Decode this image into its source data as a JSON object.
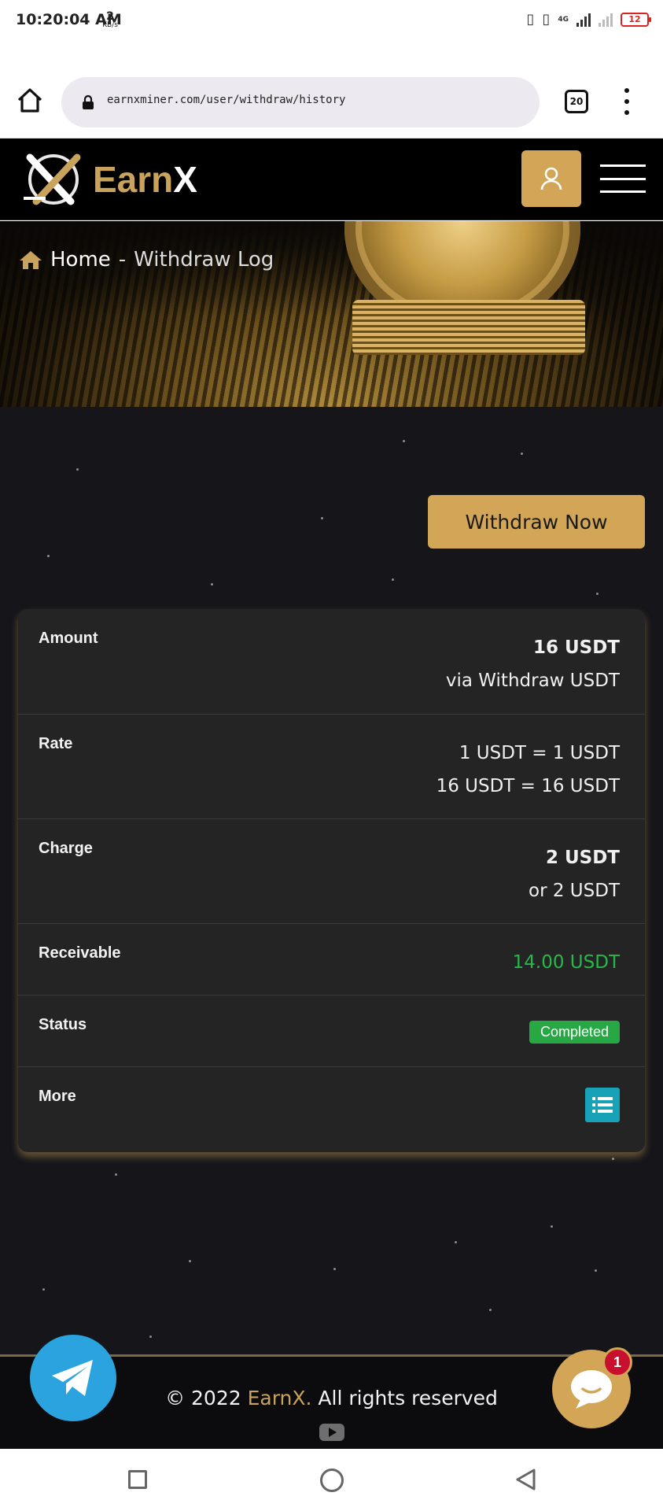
{
  "status_bar": {
    "time": "10:20:04 AM",
    "net_speed_value": "2",
    "net_speed_unit": "KB/s",
    "network_label": "4G",
    "battery_level": "12"
  },
  "browser": {
    "url": "earnxminer.com/user/withdraw/history",
    "tab_count": "20"
  },
  "site": {
    "logo_text_part1": "Earn",
    "logo_text_part2": "X"
  },
  "breadcrumb": {
    "home": "Home",
    "separator": "-",
    "current": "Withdraw Log"
  },
  "withdraw_button_label": "Withdraw Now",
  "log_entry": {
    "amount_label": "Amount",
    "amount_value": "16 USDT",
    "amount_method": "via Withdraw USDT",
    "rate_label": "Rate",
    "rate_line1": "1 USDT = 1 USDT",
    "rate_line2": "16 USDT = 16 USDT",
    "charge_label": "Charge",
    "charge_value": "2 USDT",
    "charge_alt": "or 2 USDT",
    "receivable_label": "Receivable",
    "receivable_value": "14.00 USDT",
    "status_label": "Status",
    "status_value": "Completed",
    "more_label": "More"
  },
  "footer": {
    "copyright_prefix": "© 2022 ",
    "brand": "EarnX.",
    "copyright_suffix": " All rights reserved"
  },
  "chat_unread_count": "1",
  "colors": {
    "gold_accent": "#d2a656",
    "status_green": "#28a745",
    "receivable_green": "#27b84a",
    "info_cyan": "#17a2b8",
    "telegram_blue": "#2aa3de",
    "page_background": "#15151a"
  },
  "icons": [
    "home-icon",
    "lock-icon",
    "tabs-icon",
    "more-vert-icon",
    "user-icon",
    "hamburger-icon",
    "list-icon",
    "telegram-icon",
    "chat-icon",
    "youtube-icon"
  ]
}
